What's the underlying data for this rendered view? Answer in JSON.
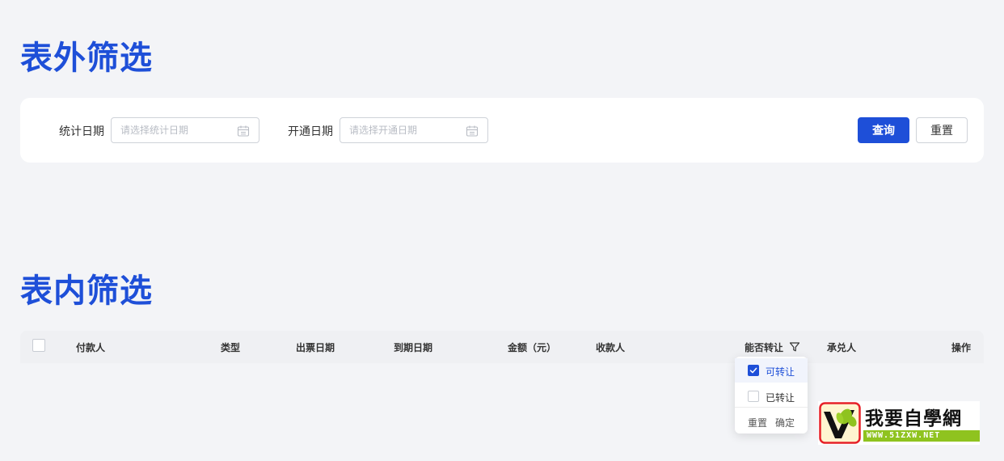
{
  "sections": {
    "outer_filter_title": "表外筛选",
    "inner_filter_title": "表内筛选"
  },
  "filter_form": {
    "stat_date": {
      "label": "统计日期",
      "placeholder": "请选择统计日期",
      "value": ""
    },
    "open_date": {
      "label": "开通日期",
      "placeholder": "请选择开通日期",
      "value": ""
    },
    "query_button": "查询",
    "reset_button": "重置"
  },
  "table": {
    "columns": [
      "付款人",
      "类型",
      "出票日期",
      "到期日期",
      "金额（元）",
      "收款人",
      "能否转让",
      "承兑人",
      "操作"
    ],
    "header_checkbox_checked": false
  },
  "transfer_filter_dropdown": {
    "options": [
      {
        "label": "可转让",
        "checked": true
      },
      {
        "label": "已转让",
        "checked": false
      }
    ],
    "reset_label": "重置",
    "confirm_label": "确定"
  },
  "watermark": {
    "name": "我要自學網",
    "url": "WWW.51ZXW.NET"
  },
  "colors": {
    "accent": "#1e4fd8",
    "background": "#f3f4f7",
    "table_header_bg": "#eff0f3",
    "watermark_green": "#8fc31f"
  },
  "icons": {
    "date_field": "calendar-icon",
    "column_filter": "filter-funnel-icon",
    "checkbox_mark": "checkmark-icon"
  }
}
